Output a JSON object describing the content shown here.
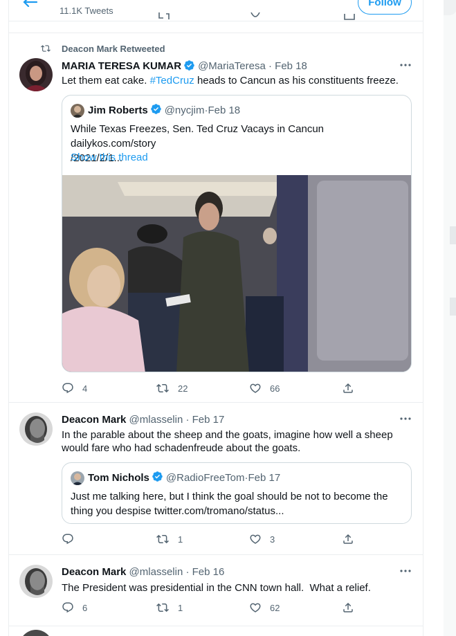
{
  "header": {
    "tweets_count": "11.1K Tweets",
    "follow_label": "Follow"
  },
  "tweet1": {
    "retweet_label": "Deacon Mark Retweeted",
    "author_name": "MARIA TERESA KUMAR",
    "author_handle": "@MariaTeresa",
    "date": "Feb 18",
    "text_before": "Let them eat cake. ",
    "hashtag": "#TedCruz",
    "text_after": " heads to Cancun as his constituents freeze.",
    "quote": {
      "author_name": "Jim Roberts",
      "author_handle": "@nycjim",
      "date": "Feb 18",
      "text_line1": "While Texas Freezes, Sen. Ted Cruz Vacays in Cancun dailykos.com/story",
      "text_line2": "/2021/2/1...",
      "show_thread": "Show this thread"
    },
    "replies": "4",
    "retweets": "22",
    "likes": "66"
  },
  "tweet2": {
    "author_name": "Deacon Mark",
    "author_handle": "@mlasselin",
    "date": "Feb 17",
    "text_line1": "In the parable about the sheep and the goats, imagine how well a sheep",
    "text_line2": "would fare who had schadenfreude about the goats.",
    "quote": {
      "author_name": "Tom Nichols",
      "author_handle": "@RadioFreeTom",
      "date": "Feb 17",
      "text_line1": "Just me talking here, but I think the goal should be not to become the",
      "text_line2": "thing you despise twitter.com/tromano/status..."
    },
    "replies": "",
    "retweets": "1",
    "likes": "3"
  },
  "tweet3": {
    "author_name": "Deacon Mark",
    "author_handle": "@mlasselin",
    "date": "Feb 16",
    "text": "The President was presidential in the CNN town hall.  What a relief.",
    "replies": "6",
    "retweets": "1",
    "likes": "62"
  },
  "colors": {
    "accent": "#1d9bf0",
    "muted": "#536471",
    "border": "#ebeef0"
  },
  "icons": [
    "back-arrow-icon",
    "retweet-icon",
    "verified-icon",
    "more-icon",
    "reply-icon",
    "like-icon",
    "share-icon"
  ]
}
